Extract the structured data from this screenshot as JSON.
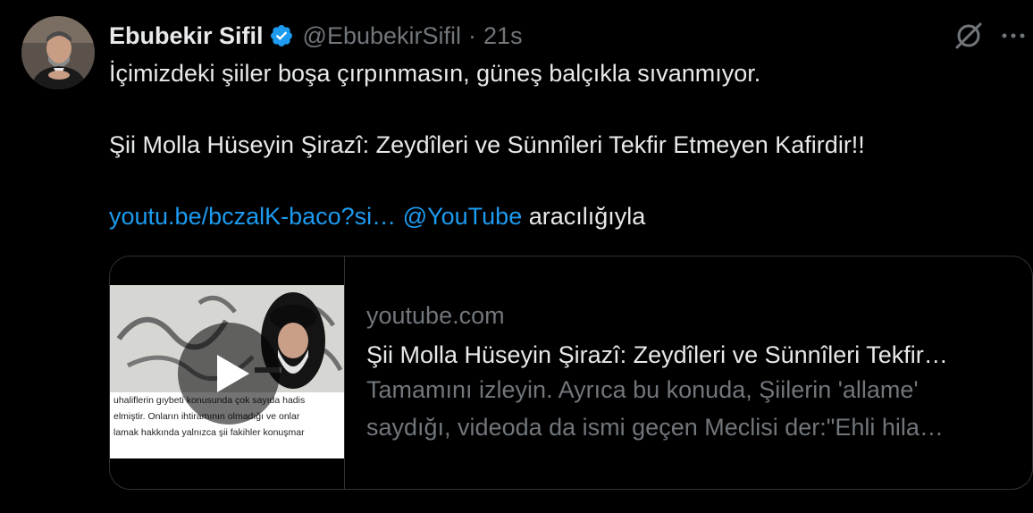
{
  "tweet": {
    "author_name": "Ebubekir Sifil",
    "handle": "@EbubekirSifil",
    "separator": "·",
    "time": "21s",
    "line1": "İçimizdeki şiiler boşa çırpınmasın, güneş balçıkla sıvanmıyor.",
    "line2": "Şii Molla Hüseyin Şirazî: Zeydîleri ve Sünnîleri Tekfir Etmeyen Kafirdir!!",
    "link_text": "youtu.be/bczalK-baco?si…",
    "mention": "@YouTube",
    "via": "aracılığıyla"
  },
  "icons": {
    "verified": "verified-badge-icon",
    "grok": "grok-icon",
    "more": "more-icon",
    "play": "play-icon"
  },
  "card": {
    "domain": "youtube.com",
    "title": "Şii Molla Hüseyin Şirazî: Zeydîleri ve Sünnîleri Tekfir…",
    "desc_line1": "Tamamını izleyin. Ayrıca bu konuda, Şiilerin 'allame'",
    "desc_line2": "saydığı, videoda da ismi geçen Meclisi der:\"Ehli hila…",
    "thumb_sub1": "uhaliflerin gıybeti konusunda çok sayıda hadis",
    "thumb_sub2": "elmiştir. Onların ihtiramının olmadığı ve onlar",
    "thumb_sub3": "lamak hakkında yalnızca şii fakihler konuşmar"
  },
  "colors": {
    "background": "#000000",
    "text": "#e7e9ea",
    "muted": "#71767b",
    "link": "#1d9bf0",
    "border": "#2f3336"
  }
}
